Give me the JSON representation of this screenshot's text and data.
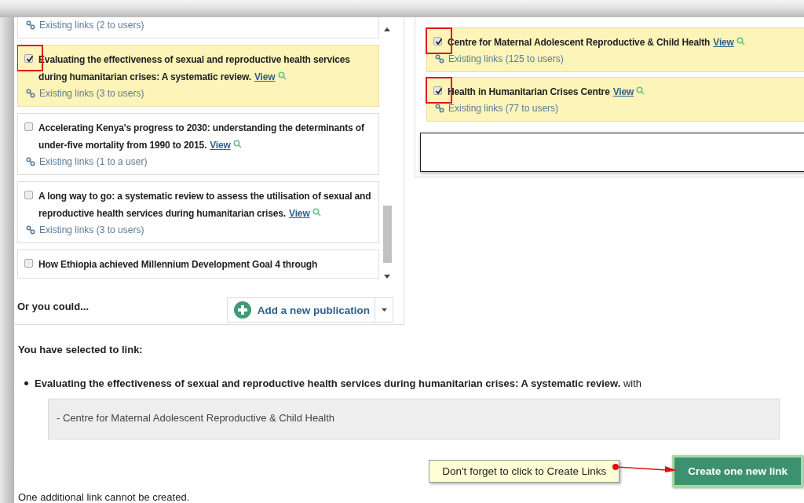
{
  "publications": {
    "items": [
      {
        "existing": "Existing links (2 to users)"
      },
      {
        "title": "Evaluating the effectiveness of sexual and reproductive health services during humanitarian crises: A systematic review.",
        "view": "View",
        "existing": "Existing links (3 to users)",
        "checked": true,
        "annotated": true
      },
      {
        "title": "Accelerating Kenya's progress to 2030: understanding the determinants of under-five mortality from 1990 to 2015.",
        "view": "View",
        "existing": "Existing links (1 to a user)",
        "checked": false,
        "annotated": false
      },
      {
        "title": "A long way to go: a systematic review to assess the utilisation of sexual and reproductive health services during humanitarian crises.",
        "view": "View",
        "existing": "Existing links (3 to users)",
        "checked": false,
        "annotated": false
      },
      {
        "title": "How Ethiopia achieved Millennium Development Goal 4 through",
        "checked": false,
        "annotated": false
      }
    ],
    "or_label": "Or you could...",
    "add_button": "Add a new publication"
  },
  "centres": {
    "items": [
      {
        "title": "Centre for Maternal Adolescent Reproductive & Child Health",
        "view": "View",
        "existing": "Existing links (125 to users)",
        "checked": true,
        "annotated": true
      },
      {
        "title": "Health in Humanitarian Crises Centre",
        "view": "View",
        "existing": "Existing links (77 to users)",
        "checked": true,
        "annotated": true
      }
    ]
  },
  "summary": {
    "heading": "You have selected to link:",
    "item": "**Evaluating the effectiveness of sexual and reproductive health services during humanitarian crises: A systematic review.** with",
    "targets": [
      "- Centre for Maternal Adolescent Reproductive & Child Health"
    ]
  },
  "callout": "Don't forget to click to Create Links",
  "create_button": "Create one new link",
  "footer": "One additional link cannot be created."
}
